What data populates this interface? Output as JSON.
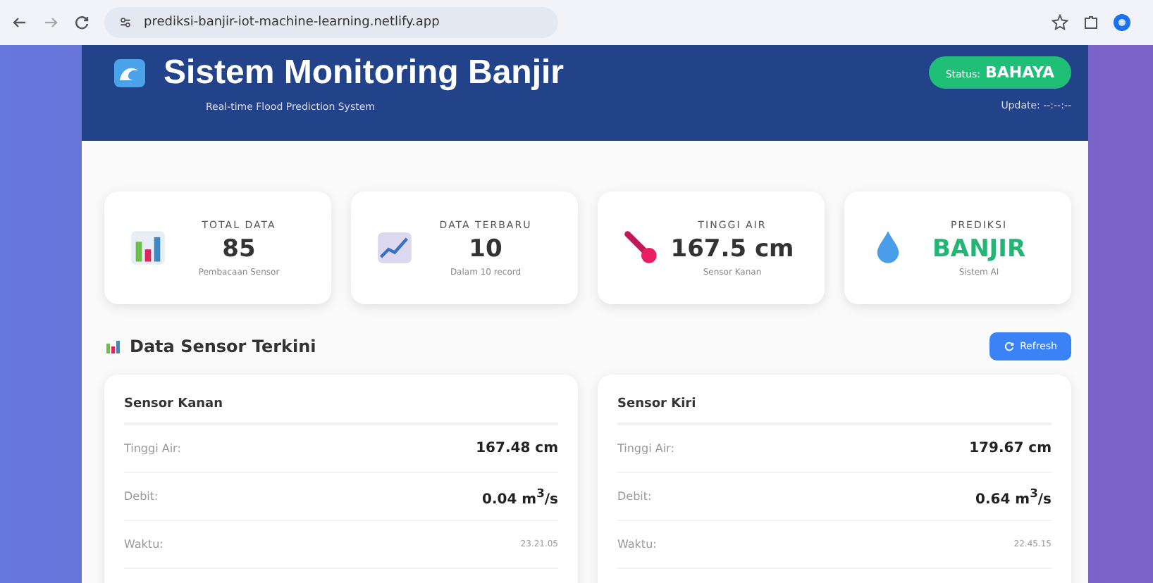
{
  "browser": {
    "url": "prediksi-banjir-iot-machine-learning.netlify.app"
  },
  "header": {
    "title": "Sistem Monitoring Banjir",
    "subtitle": "Real-time Flood Prediction System",
    "status_label": "Status:",
    "status_value": "BAHAYA",
    "update_label": "Update:",
    "update_value": "--:--:--"
  },
  "stats": [
    {
      "kind": "bars",
      "label": "TOTAL DATA",
      "value": "85",
      "caption": "Pembacaan Sensor",
      "color": "#333333"
    },
    {
      "kind": "trend",
      "label": "DATA TERBARU",
      "value": "10",
      "caption": "Dalam 10 record",
      "color": "#333333"
    },
    {
      "kind": "thermo",
      "label": "TINGGI AIR",
      "value": "167.5 cm",
      "caption": "Sensor Kanan",
      "color": "#333333"
    },
    {
      "kind": "drop",
      "label": "PREDIKSI",
      "value": "BANJIR",
      "caption": "Sistem AI",
      "color": "#22b573"
    }
  ],
  "section": {
    "title": "Data Sensor Terkini",
    "button": "Refresh"
  },
  "sensors": [
    {
      "name": "Sensor Kanan",
      "rows": [
        {
          "label": "Tinggi Air:",
          "value": "167.48 cm"
        },
        {
          "label": "Debit:",
          "value": "0.04 m$^{3}$/s"
        },
        {
          "label": "Waktu:",
          "value": "23.21.05"
        }
      ]
    },
    {
      "name": "Sensor Kiri",
      "rows": [
        {
          "label": "Tinggi Air:",
          "value": "179.67 cm"
        },
        {
          "label": "Debit:",
          "value": "0.64 m$^{3}$/s"
        },
        {
          "label": "Waktu:",
          "value": "22.45.15"
        }
      ]
    }
  ]
}
